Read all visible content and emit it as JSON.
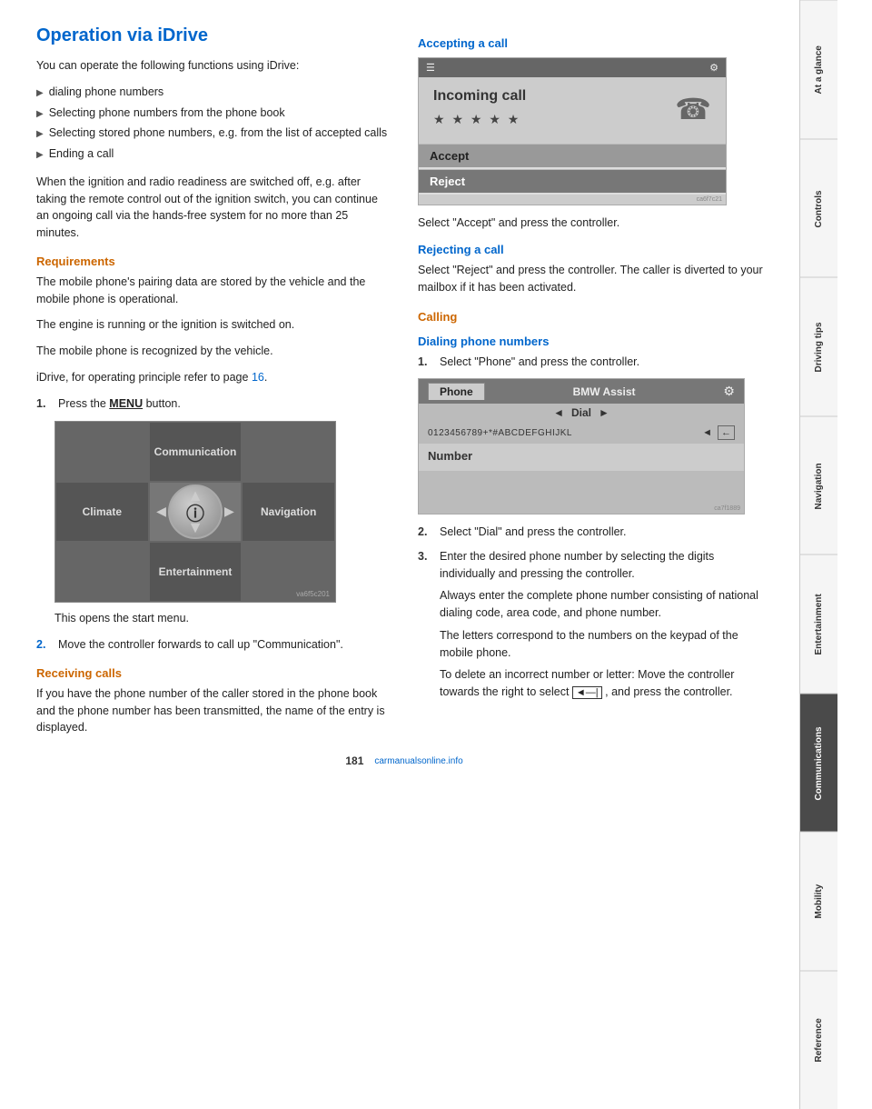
{
  "page": {
    "title": "Operation via iDrive",
    "page_number": "181",
    "footer_logo": "carmanualsonline.info"
  },
  "sidebar": {
    "tabs": [
      {
        "label": "At a glance",
        "active": false
      },
      {
        "label": "Controls",
        "active": false
      },
      {
        "label": "Driving tips",
        "active": false
      },
      {
        "label": "Navigation",
        "active": false
      },
      {
        "label": "Entertainment",
        "active": false
      },
      {
        "label": "Communications",
        "active": true
      },
      {
        "label": "Mobility",
        "active": false
      },
      {
        "label": "Reference",
        "active": false
      }
    ]
  },
  "left_col": {
    "intro_text": "You can operate the following functions using iDrive:",
    "bullets": [
      "dialing phone numbers",
      "Selecting phone numbers from the phone book",
      "Selecting stored phone numbers, e.g. from the list of accepted calls",
      "Ending a call"
    ],
    "ignition_text": "When the ignition and radio readiness are switched off, e.g. after taking the remote control out of the ignition switch, you can continue an ongoing call via the hands-free system for no more than 25 minutes.",
    "requirements_heading": "Requirements",
    "req_text1": "The mobile phone's pairing data are stored by the vehicle and the mobile phone is operational.",
    "req_text2": "The engine is running or the ignition is switched on.",
    "req_text3": "The mobile phone is recognized by the vehicle.",
    "req_text4": "iDrive, for operating principle refer to page",
    "req_link": "16",
    "step1_label": "1.",
    "step1_text": "Press the",
    "step1_menu": "MENU",
    "step1_text2": "button.",
    "idrive_caption": "This opens the start menu.",
    "step2_label": "2.",
    "step2_text": "Move the controller forwards to call up \"Communication\".",
    "receiving_heading": "Receiving calls",
    "receiving_text": "If you have the phone number of the caller stored in the phone book and the phone number has been transmitted, the name of the entry is displayed.",
    "idrive_menu": {
      "communication": "Communication",
      "climate": "Climate",
      "navigation": "Navigation",
      "entertainment": "Entertainment"
    }
  },
  "right_col": {
    "accepting_heading": "Accepting a call",
    "accepting_instruction": "Select \"Accept\" and press the controller.",
    "incoming_call": {
      "header_icon": "☰",
      "header_settings": "⚙",
      "title": "Incoming call",
      "stars": "★ ★ ★ ★ ★",
      "phone_icon": "☎",
      "accept_btn": "Accept",
      "reject_btn": "Reject",
      "watermark": "ca6f7c21"
    },
    "rejecting_heading": "Rejecting a call",
    "rejecting_text": "Select \"Reject\" and press the controller. The caller is diverted to your mailbox if it has been activated.",
    "calling_heading": "Calling",
    "dialing_heading": "Dialing phone numbers",
    "dial_step1_label": "1.",
    "dial_step1_text": "Select \"Phone\" and press the controller.",
    "phone_dial": {
      "phone_tab": "Phone",
      "bmw_assist_tab": "BMW Assist",
      "dial_arrow_left": "◄",
      "dial_label": "Dial",
      "dial_arrow_right": "►",
      "keypad_chars": "0123456789+*#ABCDEFGHIJKL",
      "backspace_icon": "◄—",
      "number_label": "Number",
      "watermark": "ca7f1889"
    },
    "dial_step2_label": "2.",
    "dial_step2_text": "Select \"Dial\" and press the controller.",
    "dial_step3_label": "3.",
    "dial_step3_text": "Enter the desired phone number by selecting the digits individually and pressing the controller.",
    "dial_step3_note1": "Always enter the complete phone number consisting of national dialing code, area code, and phone number.",
    "dial_step3_note2": "The letters correspond to the numbers on the keypad of the mobile phone.",
    "dial_step3_note3": "To delete an incorrect number or letter: Move the controller towards the right to select",
    "dial_step3_backspace": "◄—|",
    "dial_step3_note4": ", and press the controller."
  }
}
